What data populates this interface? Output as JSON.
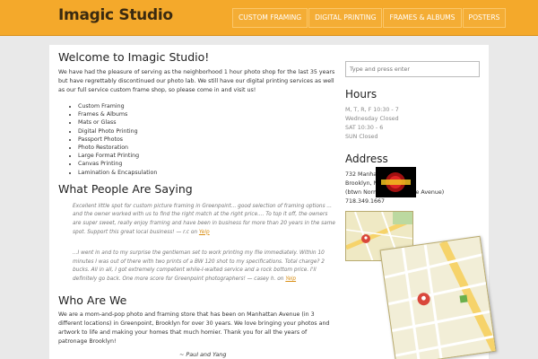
{
  "header": {
    "site_title": "Imagic Studio",
    "nav": [
      {
        "label": "Custom Framing"
      },
      {
        "label": "Digital Printing"
      },
      {
        "label": "Frames & Albums"
      },
      {
        "label": "Posters"
      }
    ]
  },
  "main": {
    "welcome_heading": "Welcome to Imagic Studio!",
    "intro": "We have had the pleasure of serving as the neighborhood 1 hour photo shop for the last 35 years but have regrettably discontinued our photo lab. We still have our digital printing services as well as our full service custom frame shop, so please come in and visit us!",
    "services": [
      "Custom Framing",
      "Frames & Albums",
      "Mats or Glass",
      "Digital Photo Printing",
      "Passport Photos",
      "Photo Restoration",
      "Large Format Printing",
      "Canvas Printing",
      "Lamination & Encapsulation"
    ],
    "reviews_heading": "What People Are Saying",
    "review1": "Excellent little spot for custom picture framing in Greenpoint... good selection of framing options ... and the owner worked with us to find the right match at the right price.... To top it off, the owners are super sweet, really enjoy framing and have been in business for more than 20 years in the same spot. Support this great local business! — r.c on",
    "review1_link": "Yelp",
    "review2": "...I went in and to my surprise the gentleman set to work printing my file immediately. Within 10 minutes I was out of there with two prints of a BW 120 shot to my specifications. Total charge? 2 bucks. All in all, I got extremely competent while-I-waited service and a rock bottom price. I'll definitely go back. One more score for Greenpoint photographers! — casey h. on",
    "review2_link": "Yelp",
    "about_heading": "Who Are We",
    "about": "We are a mom-and-pop photo and framing store that has been on Manhattan Avenue (in 3 different locations) in Greenpoint, Brooklyn for over 30 years. We love bringing your photos and artwork to life and making your homes that much homier. Thank you for all the years of patronage Brooklyn!",
    "signature": "~ Paul and Yang"
  },
  "sidebar": {
    "search_placeholder": "Type and press enter",
    "hours_heading": "Hours",
    "hours": [
      "M, T, R, F 10:30 - 7",
      "Wednesday Closed",
      "SAT 10:30 - 6",
      "SUN Closed"
    ],
    "address_heading": "Address",
    "address": [
      "732 Manhattan Avenue",
      "Brooklyn, NY 11222",
      "(btwn Norman & Meserole Avenue)",
      "718.349.1667"
    ]
  },
  "colors": {
    "header_bg": "#f4a92b",
    "link": "#d98f16"
  }
}
